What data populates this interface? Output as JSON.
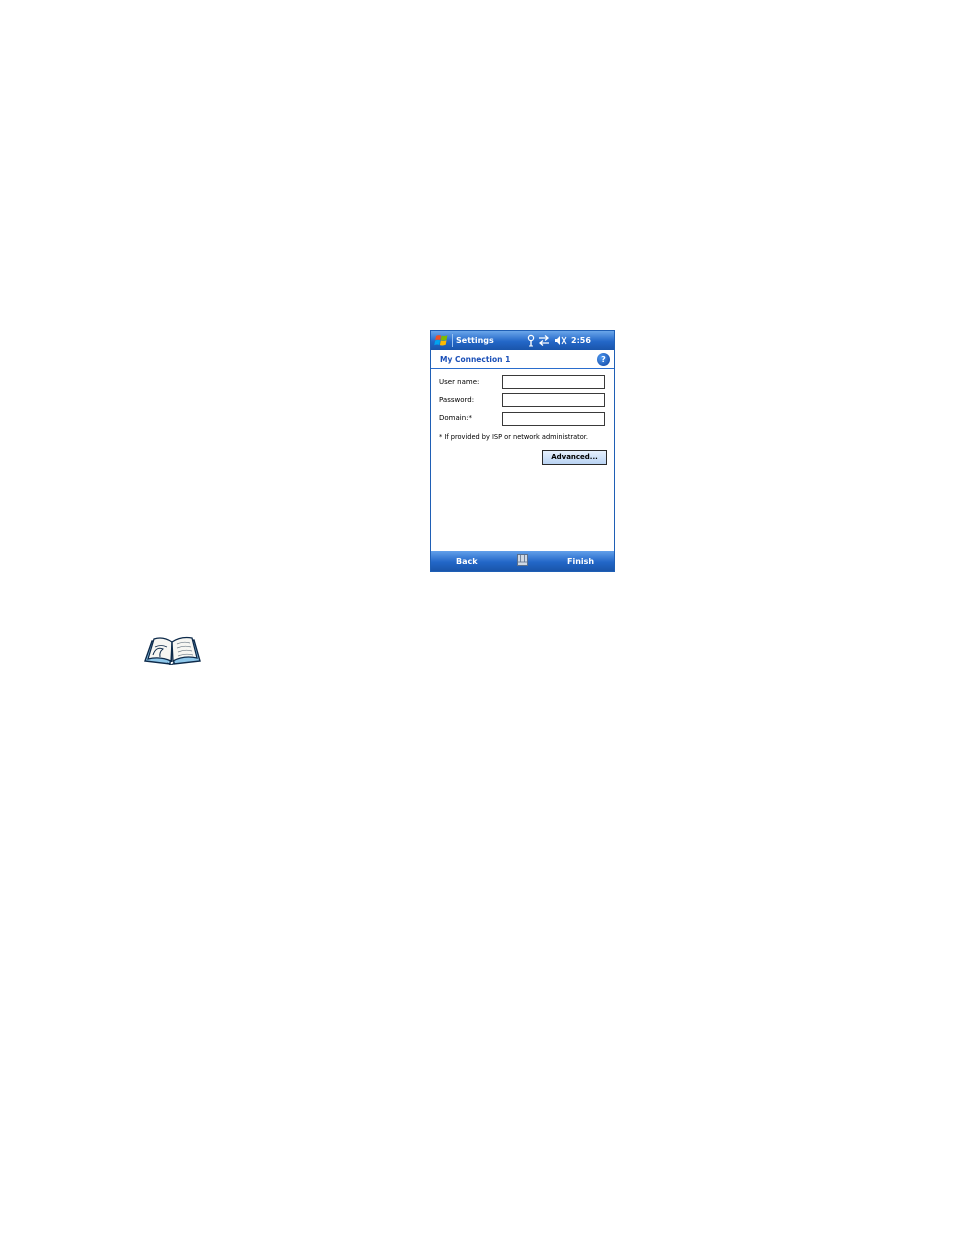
{
  "titlebar": {
    "title": "Settings",
    "clock": "2:56",
    "icons": [
      "windows-start-icon",
      "antenna-icon",
      "connectivity-icon",
      "speaker-icon"
    ]
  },
  "header": {
    "title": "My Connection 1",
    "help_icon": "help-icon",
    "help_glyph": "?"
  },
  "form": {
    "username_label": "User name:",
    "username_value": "",
    "password_label": "Password:",
    "password_value": "",
    "domain_label": "Domain:*",
    "domain_value": "",
    "note": "* If provided by ISP or network administrator.",
    "advanced_label": "Advanced..."
  },
  "menubar": {
    "left": "Back",
    "right": "Finish",
    "center_icon": "keyboard-icon"
  },
  "page": {
    "note_icon": "book-icon"
  },
  "colors": {
    "bar_blue": "#2367c8",
    "header_text": "#1b50b8",
    "button_face": "#b9d3f3"
  }
}
